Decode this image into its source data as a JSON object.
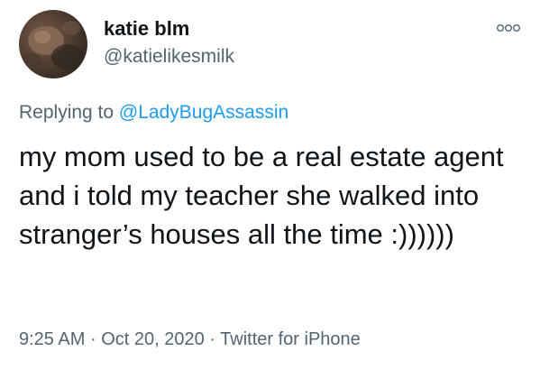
{
  "tweet": {
    "author": {
      "display_name": "katie blm",
      "handle": "@katielikesmilk",
      "avatar_icon": "profile-photo"
    },
    "more_icon": "more-options-icon",
    "reply": {
      "prefix": "Replying to",
      "mention": "@LadyBugAssassin"
    },
    "text": "my mom used to be a real estate agent and i told my teacher she walked into stranger’s houses all the time :))))))",
    "meta": {
      "time": "9:25 AM",
      "date": "Oct 20, 2020",
      "separator": "·",
      "source": "Twitter for iPhone"
    }
  },
  "colors": {
    "text": "#0f1419",
    "secondary": "#536471",
    "link": "#1d9bf0",
    "background": "#ffffff"
  }
}
